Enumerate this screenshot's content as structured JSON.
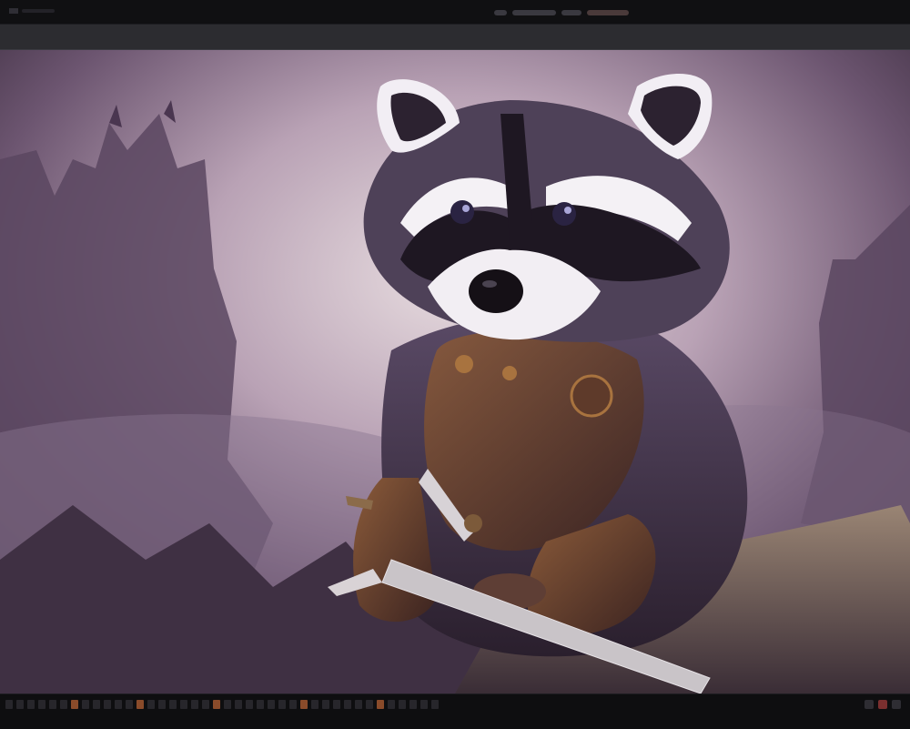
{
  "window": {
    "title": "",
    "controls": [
      "app-icon",
      "view-toggle",
      "zoom-slider",
      "menu-pill"
    ]
  },
  "canvas": {
    "subject": "raccoon-warrior-illustration",
    "colors": {
      "sky_light": "#e2d6da",
      "sky_mid": "#b59bb0",
      "mountain_dark": "#4d3a4f",
      "fur_dark": "#2a2230",
      "fur_light": "#f1eef3",
      "armor": "#6a4330",
      "blade": "#c9c4c8"
    }
  },
  "statusbar": {
    "items": [
      "frame-strip",
      "timeline",
      "status-dots"
    ]
  }
}
